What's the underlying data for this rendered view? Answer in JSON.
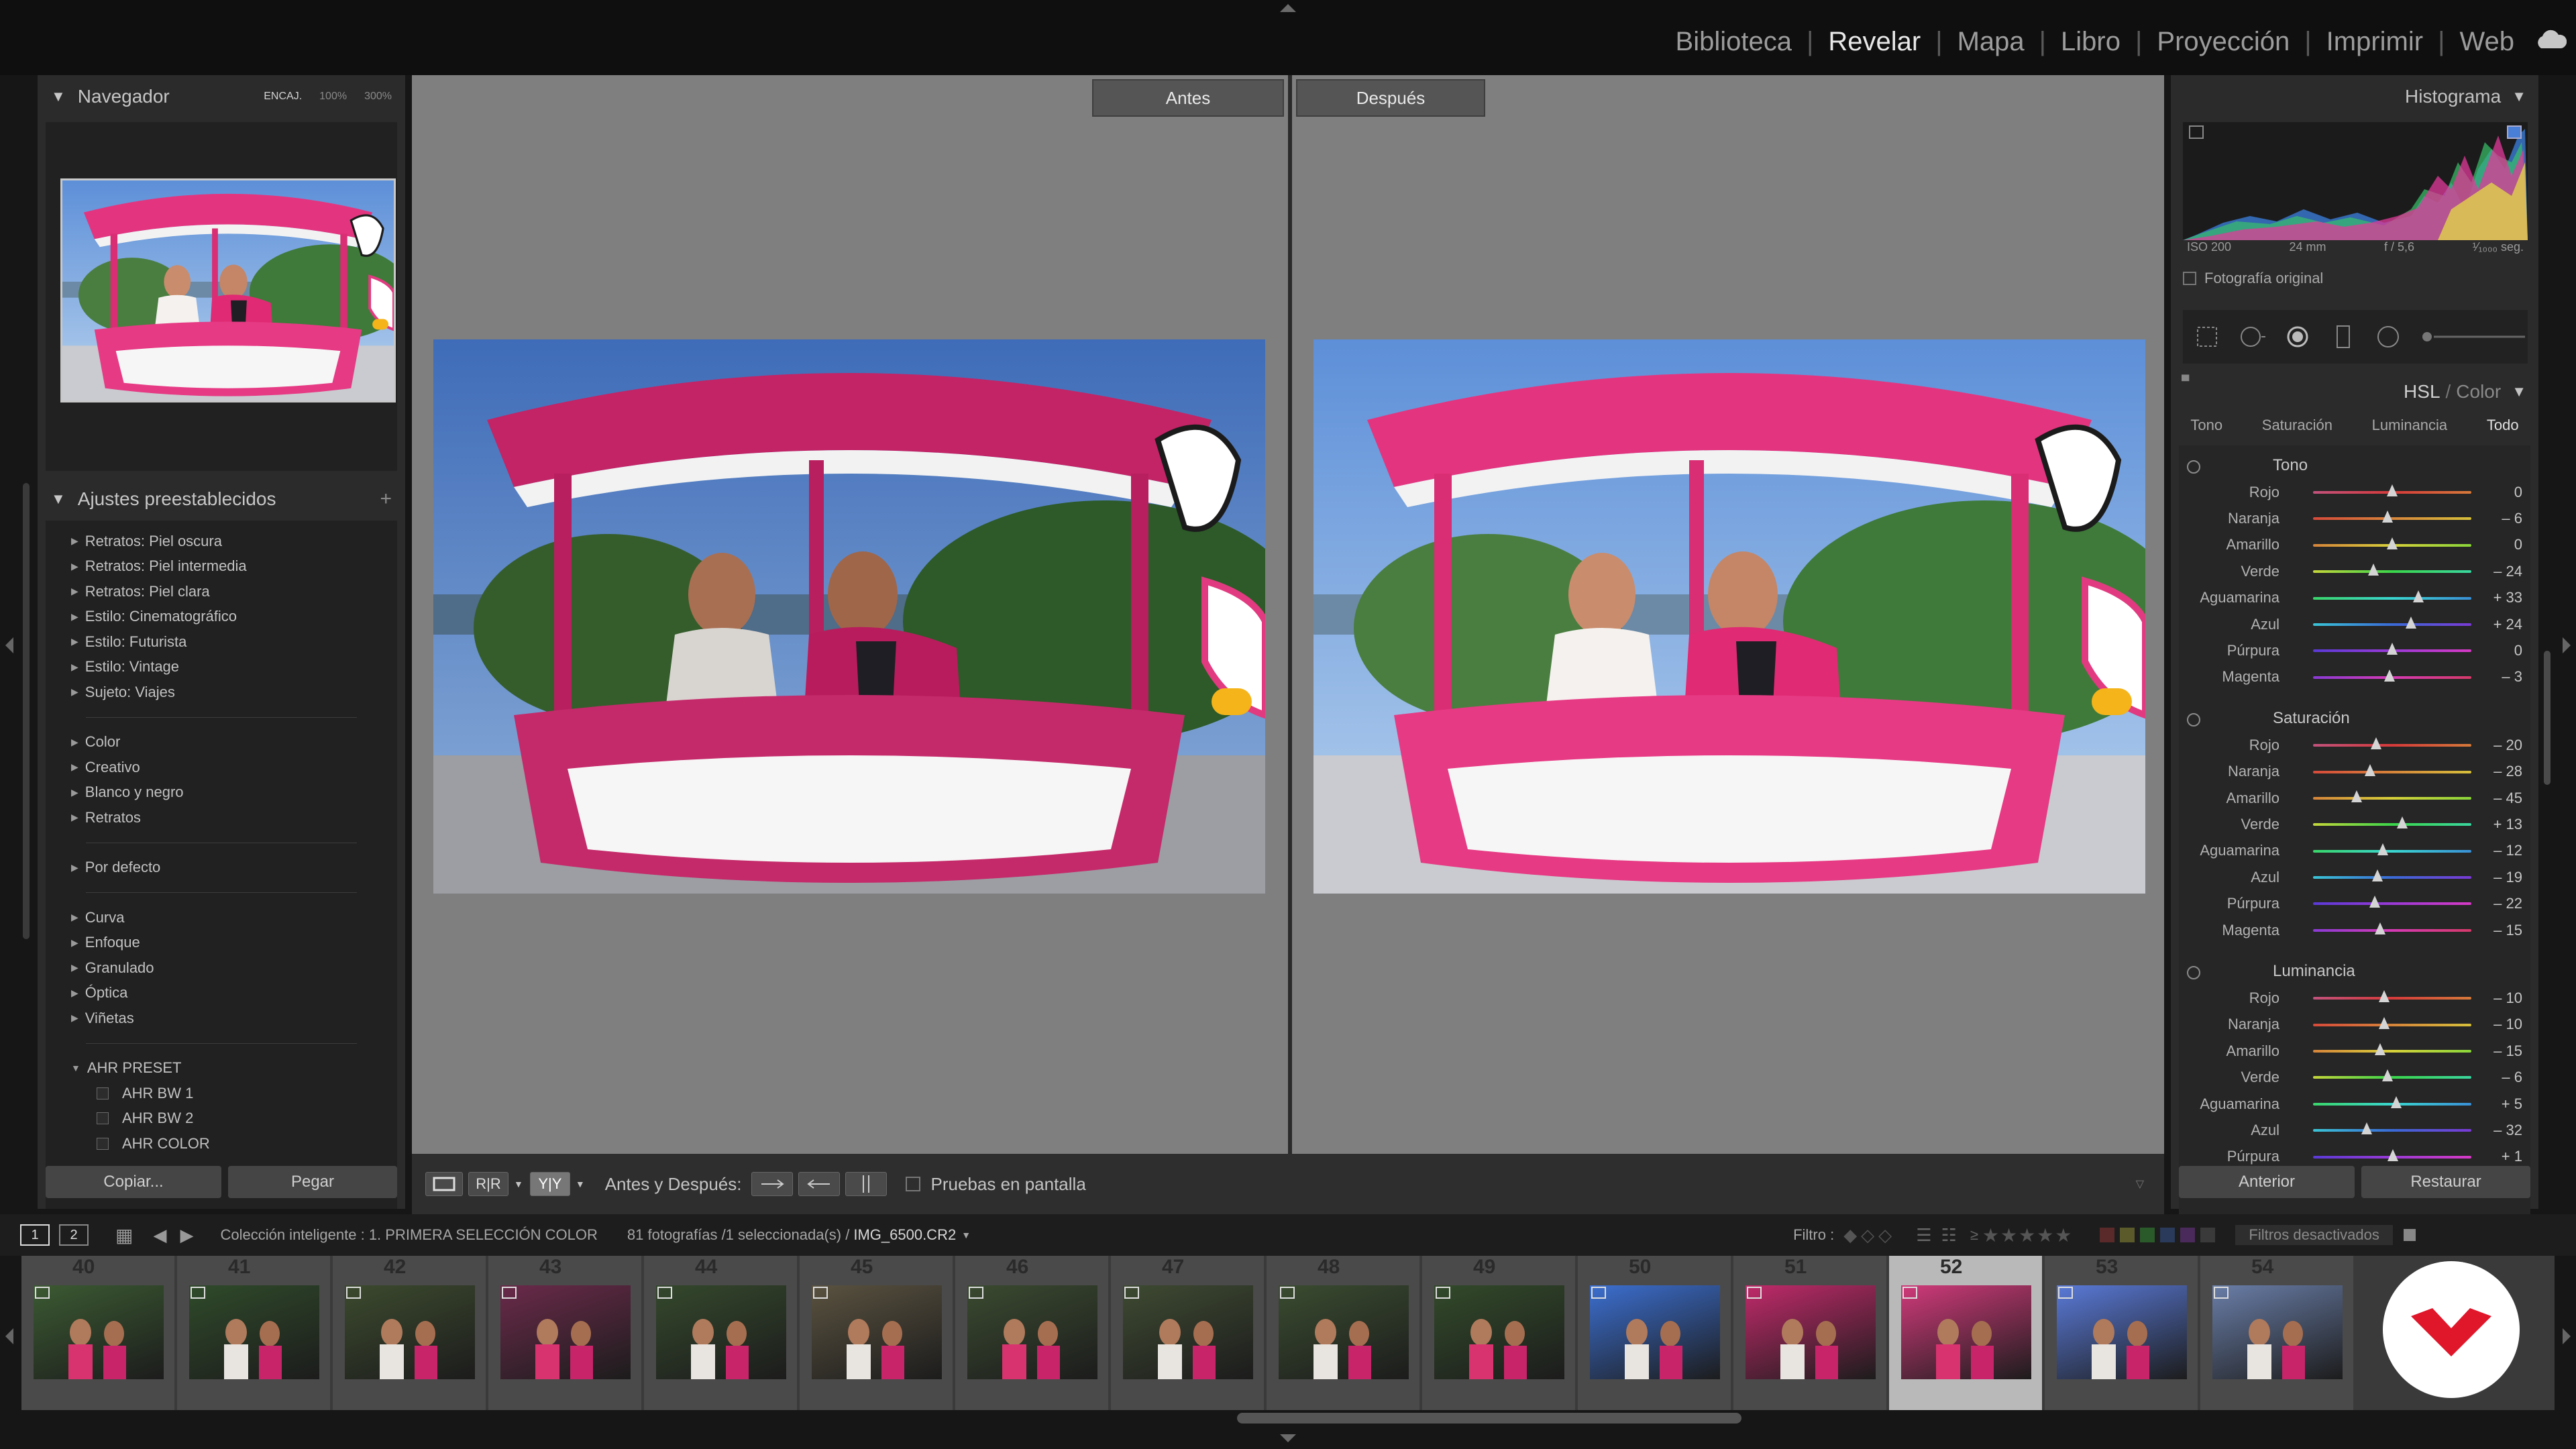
{
  "modules": [
    "Biblioteca",
    "Revelar",
    "Mapa",
    "Libro",
    "Proyección",
    "Imprimir",
    "Web"
  ],
  "active_module": "Revelar",
  "navigator": {
    "title": "Navegador",
    "zoom": [
      "ENCAJ.",
      "100%",
      "300%"
    ]
  },
  "presets": {
    "title": "Ajustes preestablecidos",
    "groups": [
      [
        "Retratos: Piel oscura",
        "Retratos: Piel intermedia",
        "Retratos: Piel clara",
        "Estilo: Cinematográfico",
        "Estilo: Futurista",
        "Estilo: Vintage",
        "Sujeto: Viajes"
      ],
      [
        "Color",
        "Creativo",
        "Blanco y negro",
        "Retratos"
      ],
      [
        "Por defecto"
      ],
      [
        "Curva",
        "Enfoque",
        "Granulado",
        "Óptica",
        "Viñetas"
      ]
    ],
    "custom_group": "AHR PRESET",
    "custom_items": [
      "AHR BW 1",
      "AHR BW 2",
      "AHR COLOR"
    ]
  },
  "left_buttons": {
    "copy": "Copiar...",
    "paste": "Pegar"
  },
  "compare": {
    "before": "Antes",
    "after": "Después"
  },
  "toolbar": {
    "before_after_label": "Antes y Después:",
    "softproof_label": "Pruebas en pantalla"
  },
  "histogram": {
    "title": "Histograma",
    "iso": "ISO 200",
    "focal": "24 mm",
    "aperture": "f / 5,6",
    "shutter": "¹⁄₁₀₀₀ seg.",
    "original_photo": "Fotografía original"
  },
  "hsl": {
    "title": "HSL",
    "title_sep": "/",
    "title_alt": "Color",
    "tabs": [
      "Tono",
      "Saturación",
      "Luminancia",
      "Todo"
    ],
    "sections": [
      {
        "name": "Tono",
        "rows": [
          [
            "Rojo",
            "0",
            0
          ],
          [
            "Naranja",
            "– 6",
            -6
          ],
          [
            "Amarillo",
            "0",
            0
          ],
          [
            "Verde",
            "– 24",
            -24
          ],
          [
            "Aguamarina",
            "+ 33",
            33
          ],
          [
            "Azul",
            "+ 24",
            24
          ],
          [
            "Púrpura",
            "0",
            0
          ],
          [
            "Magenta",
            "– 3",
            -3
          ]
        ]
      },
      {
        "name": "Saturación",
        "rows": [
          [
            "Rojo",
            "– 20",
            -20
          ],
          [
            "Naranja",
            "– 28",
            -28
          ],
          [
            "Amarillo",
            "– 45",
            -45
          ],
          [
            "Verde",
            "+ 13",
            13
          ],
          [
            "Aguamarina",
            "– 12",
            -12
          ],
          [
            "Azul",
            "– 19",
            -19
          ],
          [
            "Púrpura",
            "– 22",
            -22
          ],
          [
            "Magenta",
            "– 15",
            -15
          ]
        ]
      },
      {
        "name": "Luminancia",
        "rows": [
          [
            "Rojo",
            "– 10",
            -10
          ],
          [
            "Naranja",
            "– 10",
            -10
          ],
          [
            "Amarillo",
            "– 15",
            -15
          ],
          [
            "Verde",
            "– 6",
            -6
          ],
          [
            "Aguamarina",
            "+ 5",
            5
          ],
          [
            "Azul",
            "– 32",
            -32
          ],
          [
            "Púrpura",
            "+ 1",
            1
          ]
        ]
      }
    ]
  },
  "right_buttons": {
    "prev": "Anterior",
    "reset": "Restaurar"
  },
  "filmbar": {
    "page1": "1",
    "page2": "2",
    "collection": "Colección inteligente : 1. PRIMERA SELECCIÓN COLOR",
    "count": "81 fotografías /1 seleccionada(s) /",
    "filename": "IMG_6500.CR2",
    "filter_label": "Filtro :",
    "filter_state": "Filtros desactivados"
  },
  "filmstrip": {
    "numbers": [
      "40",
      "41",
      "42",
      "43",
      "44",
      "45",
      "46",
      "47",
      "48",
      "49",
      "50",
      "51",
      "52",
      "53",
      "54"
    ],
    "selected": "52"
  }
}
